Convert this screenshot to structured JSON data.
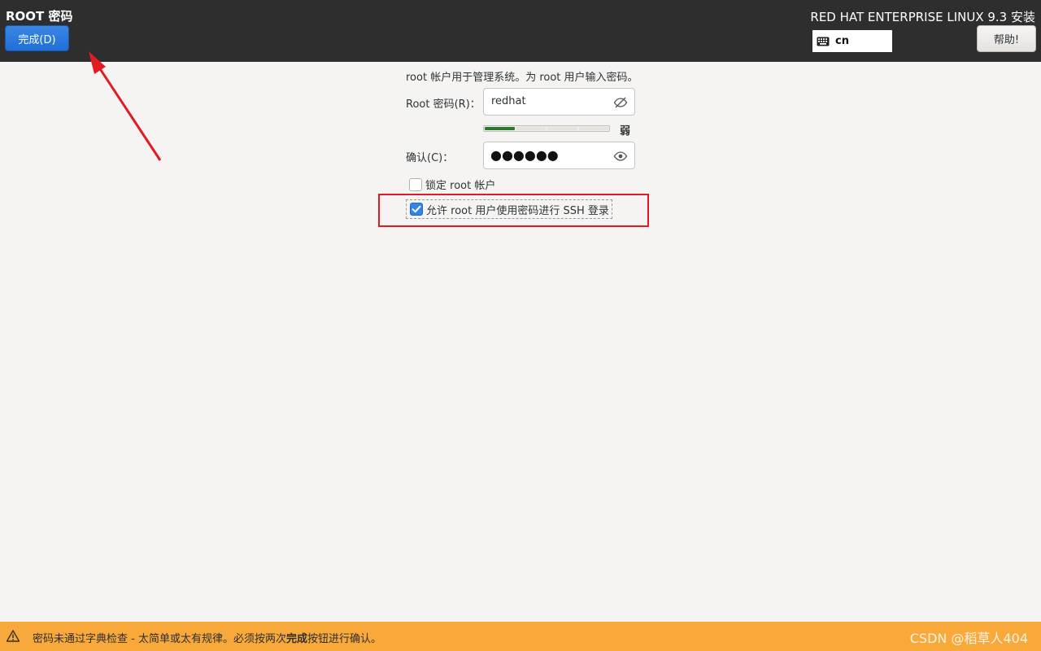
{
  "header": {
    "page_title": "ROOT 密码",
    "done_button": "完成(D)",
    "product_title": "RED HAT ENTERPRISE LINUX 9.3 安装",
    "keyboard_layout": "cn",
    "help_button": "帮助!"
  },
  "form": {
    "intro": "root 帐户用于管理系统。为 root 用户输入密码。",
    "password_label": "Root 密码(R)：",
    "password_value": "redhat",
    "strength_label": "弱",
    "strength_level": 0.25,
    "confirm_label": "确认(C)：",
    "confirm_masked": "●●●●●●",
    "lock_root_label": "锁定 root 帐户",
    "lock_root_checked": false,
    "allow_ssh_label": "允许 root 用户使用密码进行 SSH 登录",
    "allow_ssh_checked": true
  },
  "status_bar": {
    "message_before": "密码未通过字典检查 - 太简单或太有规律。必须按两次",
    "message_bold": "完成",
    "message_after": "按钮进行确认。"
  },
  "watermark": "CSDN @稻草人404",
  "colors": {
    "header_bg": "#2e2e2e",
    "accent_blue": "#3584e4",
    "warning_bar": "#f8a93a",
    "annotation_red": "#e01b24",
    "strength_green": "#2b7a2b"
  },
  "icons": [
    "keyboard-icon",
    "eye-slash-icon",
    "eye-icon",
    "checkmark-icon",
    "warning-icon"
  ]
}
